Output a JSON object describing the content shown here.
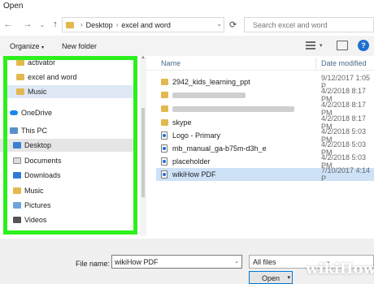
{
  "window": {
    "title": "Open"
  },
  "address": {
    "crumbs": [
      "Desktop",
      "excel and word"
    ],
    "search_placeholder": "Search excel and word"
  },
  "toolbar": {
    "organize_label": "Organize",
    "new_folder_label": "New folder",
    "help_label": "?"
  },
  "nav_pane": {
    "items": [
      {
        "label": "activator",
        "icon": "folder-icon"
      },
      {
        "label": "excel and word",
        "icon": "folder-icon"
      },
      {
        "label": "Music",
        "icon": "folder-icon"
      },
      {
        "label": "OneDrive",
        "icon": "onedrive-icon"
      },
      {
        "label": "This PC",
        "icon": "this-pc-icon"
      },
      {
        "label": "Desktop",
        "icon": "desktop-icon"
      },
      {
        "label": "Documents",
        "icon": "documents-icon"
      },
      {
        "label": "Downloads",
        "icon": "downloads-icon"
      },
      {
        "label": "Music",
        "icon": "music-icon"
      },
      {
        "label": "Pictures",
        "icon": "pictures-icon"
      },
      {
        "label": "Videos",
        "icon": "videos-icon"
      }
    ]
  },
  "file_list": {
    "columns": [
      "Name",
      "Date modified"
    ],
    "rows": [
      {
        "name": "2942_kids_learning_ppt",
        "date": "9/12/2017 1:05 P",
        "icon": "folder-icon"
      },
      {
        "name": "",
        "date": "4/2/2018 8:17 PM",
        "icon": "folder-icon"
      },
      {
        "name": "",
        "date": "4/2/2018 8:17 PM",
        "icon": "folder-icon"
      },
      {
        "name": "skype",
        "date": "4/2/2018 8:17 PM",
        "icon": "folder-icon"
      },
      {
        "name": "Logo - Primary",
        "date": "4/2/2018 5:03 PM",
        "icon": "document-icon"
      },
      {
        "name": "mb_manual_ga-b75m-d3h_e",
        "date": "4/2/2018 5:03 PM",
        "icon": "document-icon"
      },
      {
        "name": "placeholder",
        "date": "4/2/2018 5:03 PM",
        "icon": "document-icon"
      },
      {
        "name": "wikiHow PDF",
        "date": "7/10/2017 4:14 P",
        "icon": "document-icon"
      }
    ]
  },
  "bottom": {
    "file_name_label": "File name:",
    "file_name_value": "wikiHow PDF",
    "filter_value": "All files",
    "open_label": "Open"
  },
  "watermark": {
    "text": "wikiHow"
  },
  "colors": {
    "highlight_border": "#2cf01d",
    "selection": "#cde2f7",
    "accent": "#0078d7"
  }
}
